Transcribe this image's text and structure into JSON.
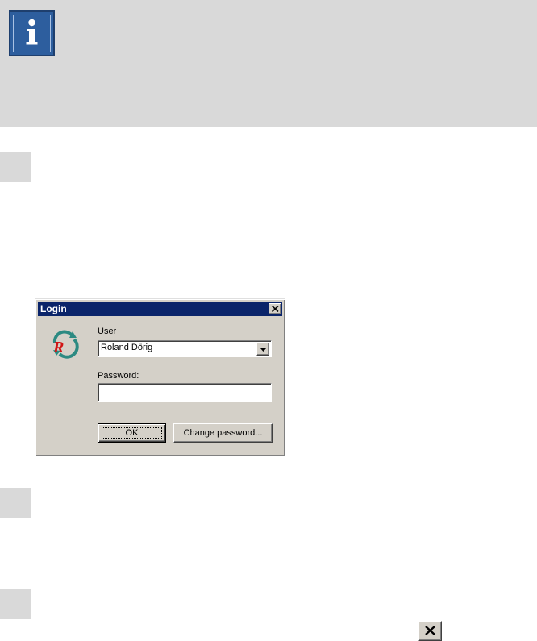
{
  "info_banner": {
    "icon": "info-icon",
    "colors": {
      "background": "#d9d9d9",
      "icon_blue": "#2d5e9e"
    }
  },
  "steps": [
    {
      "id": "step-1"
    },
    {
      "id": "step-2"
    },
    {
      "id": "step-3"
    }
  ],
  "login_dialog": {
    "title": "Login",
    "close_icon": "close-icon",
    "logo_icon": "app-logo-icon",
    "user_label": "User",
    "user_value": "Roland Dörig",
    "password_label": "Password:",
    "password_value": "",
    "ok_label": "OK",
    "change_password_label": "Change password...",
    "colors": {
      "titlebar": "#0a246a",
      "face": "#d4d0c8"
    }
  },
  "inline_close_icon": "close-icon"
}
